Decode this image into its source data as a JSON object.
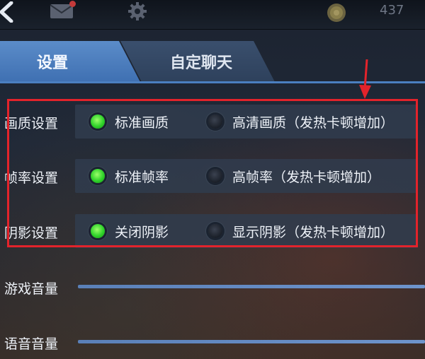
{
  "topbar": {
    "coin_count": "437",
    "icons": [
      "back-icon",
      "mail-icon",
      "gear-icon",
      "coin-icon"
    ]
  },
  "tabs": [
    {
      "label": "设置",
      "active": true
    },
    {
      "label": "自定聊天",
      "active": false
    }
  ],
  "settings": {
    "quality": {
      "label": "画质设置",
      "options": [
        {
          "label": "标准画质",
          "selected": true
        },
        {
          "label": "高清画质（发热卡顿增加）",
          "selected": false
        }
      ]
    },
    "framerate": {
      "label": "帧率设置",
      "options": [
        {
          "label": "标准帧率",
          "selected": true
        },
        {
          "label": "高帧率（发热卡顿增加）",
          "selected": false
        }
      ]
    },
    "shadow": {
      "label": "阴影设置",
      "options": [
        {
          "label": "关闭阴影",
          "selected": true
        },
        {
          "label": "显示阴影（发热卡顿增加）",
          "selected": false
        }
      ]
    }
  },
  "volume": {
    "game_label": "游戏音量",
    "voice_label": "语音音量"
  },
  "colors": {
    "highlight": "#e3232b",
    "active_tab": "#4a7cbd",
    "radio_on": "#2fd22a"
  }
}
